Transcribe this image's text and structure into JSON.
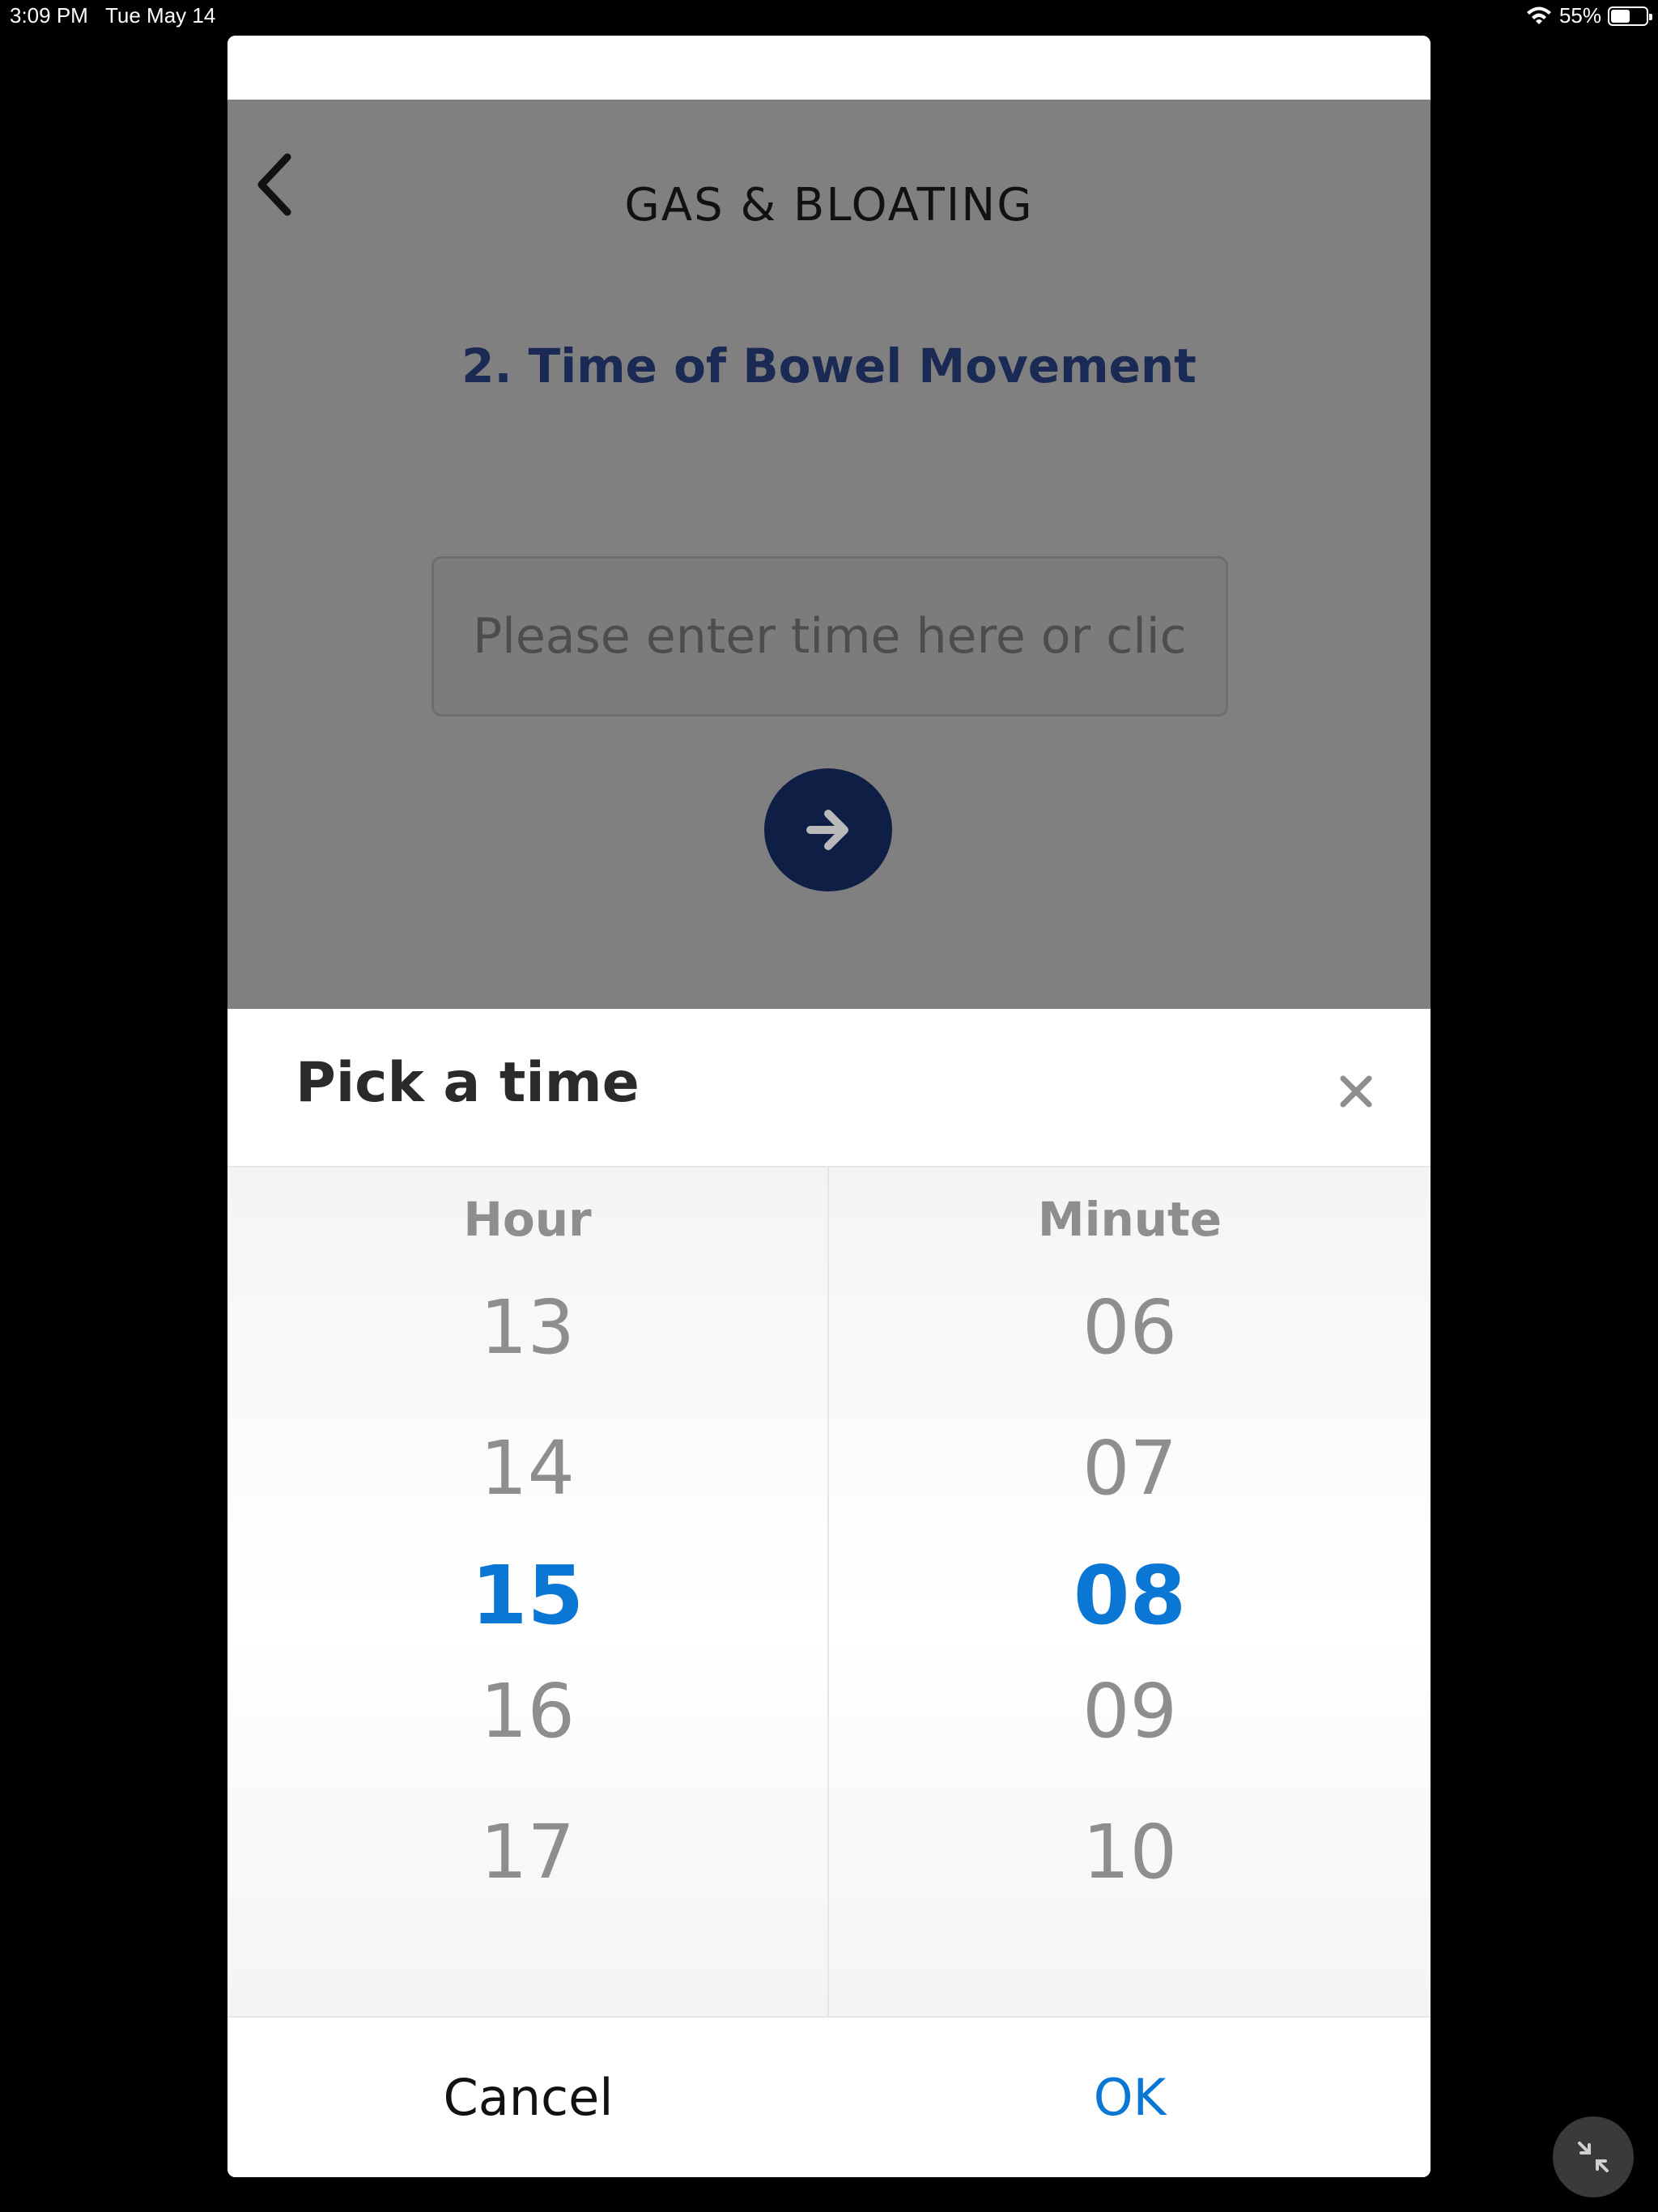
{
  "status_bar": {
    "time": "3:09 PM",
    "date": "Tue May 14",
    "battery": "55%",
    "battery_level": 0.55
  },
  "header": {
    "title": "GAS & BLOATING"
  },
  "question": {
    "title": "2. Time of Bowel Movement"
  },
  "time_input": {
    "placeholder": "Please enter time here or click",
    "value": ""
  },
  "picker": {
    "title": "Pick a time",
    "hour_label": "Hour",
    "minute_label": "Minute",
    "hours": [
      "13",
      "14",
      "15",
      "16",
      "17"
    ],
    "minutes": [
      "06",
      "07",
      "08",
      "09",
      "10"
    ],
    "selected_hour": "15",
    "selected_minute": "08",
    "cancel_label": "Cancel",
    "ok_label": "OK"
  },
  "colors": {
    "accent": "#0a77d4",
    "navy": "#1b2a55",
    "button_navy": "#0f1e44",
    "overlay_gray": "#808080"
  },
  "icons": [
    "wifi-icon",
    "battery-icon",
    "chevron-left-icon",
    "arrow-right-icon",
    "close-icon",
    "collapse-icon"
  ]
}
